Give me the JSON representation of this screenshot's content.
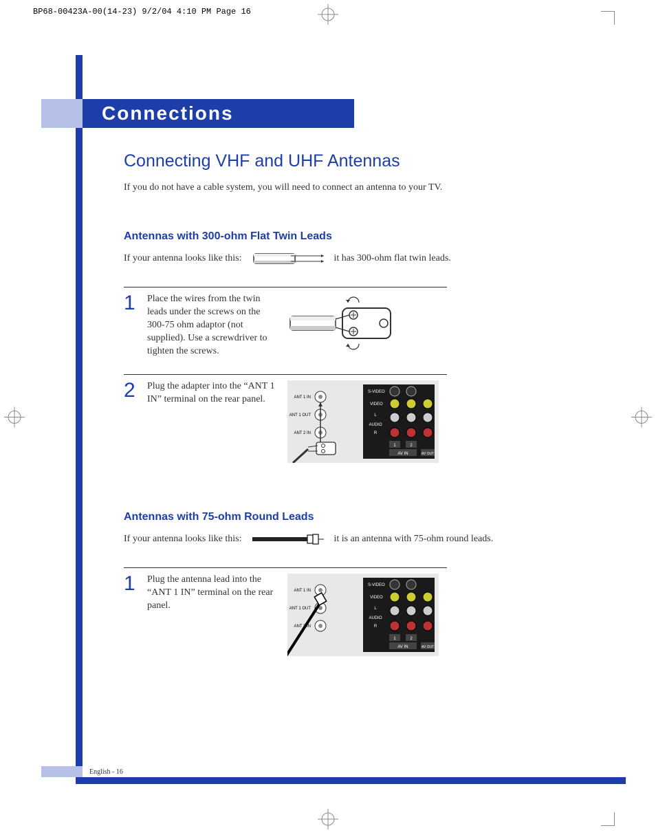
{
  "print_header": "BP68-00423A-00(14-23)  9/2/04  4:10 PM  Page 16",
  "chapter_title": "Connections",
  "h1": "Connecting VHF and UHF Antennas",
  "intro": "If you do not have a cable system, you will need to connect an antenna to your TV.",
  "section_a": {
    "heading": "Antennas with 300-ohm Flat Twin Leads",
    "lead_before": "If your antenna looks like this:",
    "lead_after": "it has 300-ohm flat twin leads.",
    "steps": [
      {
        "num": "1",
        "text": "Place the wires from the twin leads under the screws on the 300-75 ohm adaptor (not supplied). Use a screwdriver to tighten the screws."
      },
      {
        "num": "2",
        "text": "Plug the adapter into the “ANT 1 IN” terminal on the rear panel."
      }
    ]
  },
  "section_b": {
    "heading": "Antennas with 75-ohm Round Leads",
    "lead_before": "If your antenna looks like this:",
    "lead_after": "it is an antenna with 75-ohm round leads.",
    "steps": [
      {
        "num": "1",
        "text": "Plug the antenna lead into the “ANT 1 IN” terminal on the rear panel."
      }
    ]
  },
  "panel_labels": {
    "ant1in": "ANT 1 IN",
    "ant1out": "ANT 1 OUT",
    "ant2in": "ANT 2 IN",
    "svideo": "S-VIDEO",
    "video": "VIDEO",
    "audio_l": "L",
    "audio": "AUDIO",
    "audio_r": "R",
    "avin": "AV IN",
    "avout": "AV OUT",
    "col1": "1",
    "col2": "2"
  },
  "footer": "English - 16"
}
